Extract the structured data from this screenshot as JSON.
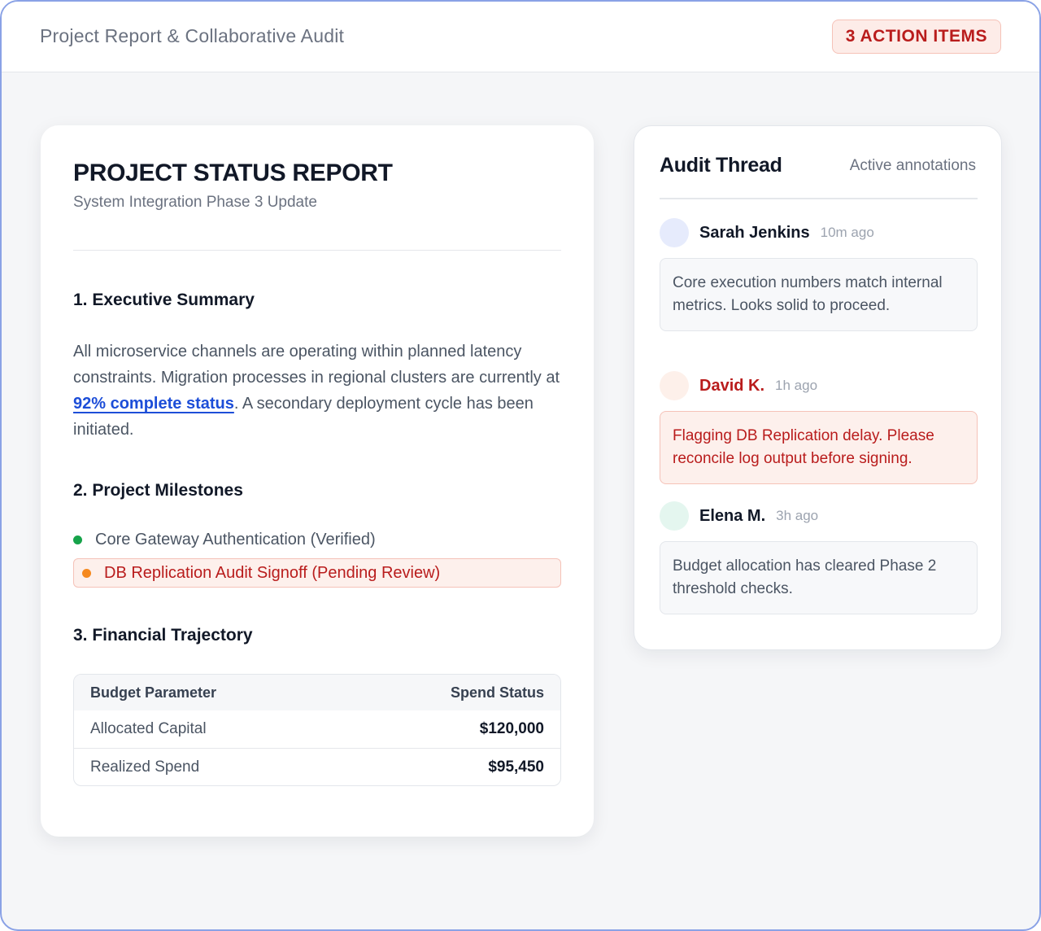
{
  "header": {
    "title": "Project Report & Collaborative Audit",
    "badge": "3 ACTION ITEMS"
  },
  "report": {
    "title": "PROJECT STATUS REPORT",
    "subtitle": "System Integration Phase 3 Update",
    "sections": {
      "summary_heading": "1. Executive Summary",
      "summary_text_before": "All microservice channels are operating within planned latency constraints. Migration processes in regional clusters are currently at ",
      "summary_link": "92% complete status",
      "summary_text_after": ". A secondary deployment cycle has been initiated.",
      "milestones_heading": "2. Project Milestones",
      "milestones": [
        {
          "label": "Core Gateway Authentication (Verified)",
          "status": "verified"
        },
        {
          "label": "DB Replication Audit Signoff (Pending Review)",
          "status": "pending"
        }
      ],
      "financial_heading": "3. Financial Trajectory",
      "financial_table": {
        "columns": [
          "Budget Parameter",
          "Spend Status"
        ],
        "rows": [
          {
            "label": "Allocated Capital",
            "value": "$120,000"
          },
          {
            "label": "Realized Spend",
            "value": "$95,450"
          }
        ]
      }
    }
  },
  "audit": {
    "title": "Audit Thread",
    "subtitle": "Active annotations",
    "comments": [
      {
        "author": "Sarah Jenkins",
        "time": "10m ago",
        "text": "Core execution numbers match internal metrics. Looks solid to proceed.",
        "avatar_color": "#e6ebfc"
      },
      {
        "author": "David K.",
        "time": "1h ago",
        "text": "Flagging DB Replication delay. Please reconcile log output before signing.",
        "avatar_color": "#fdf0ea"
      },
      {
        "author": "Elena M.",
        "time": "3h ago",
        "text": "Budget allocation has cleared Phase 2 threshold checks.",
        "avatar_color": "#e4f6ef"
      }
    ]
  }
}
